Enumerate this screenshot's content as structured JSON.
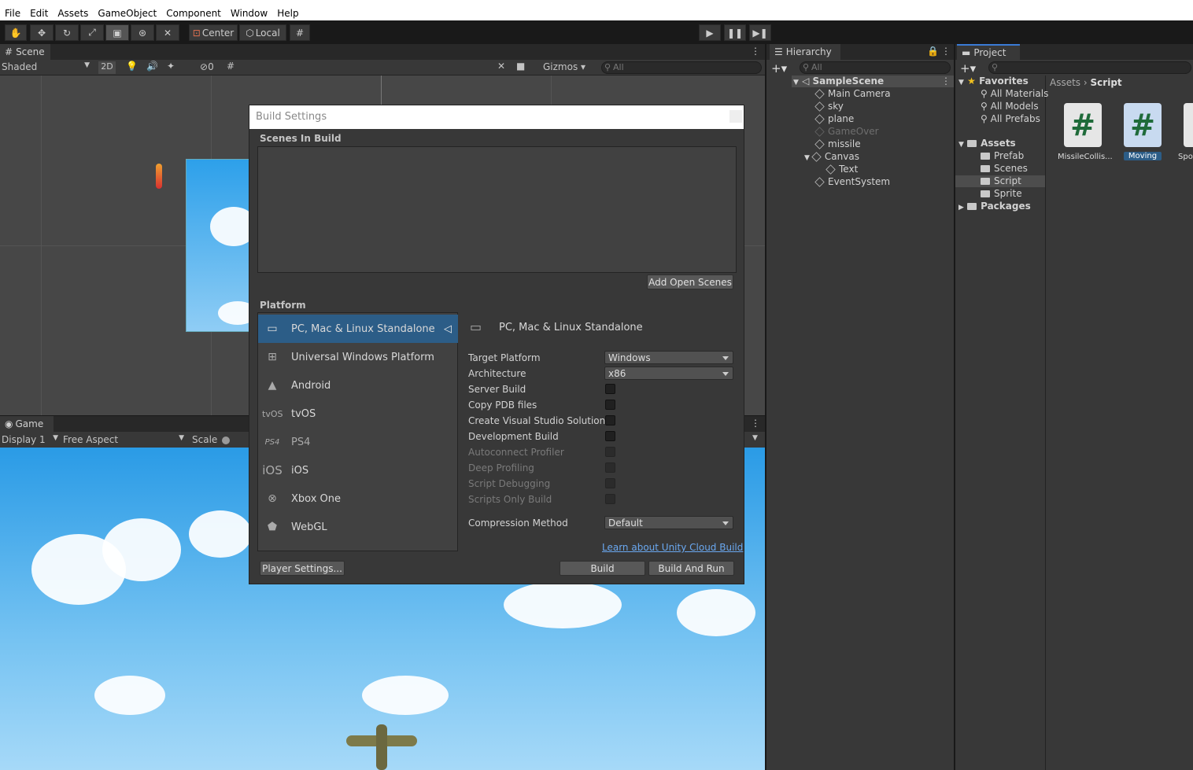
{
  "menu": [
    "File",
    "Edit",
    "Assets",
    "GameObject",
    "Component",
    "Window",
    "Help"
  ],
  "toolbar": {
    "center": "Center",
    "local": "Local"
  },
  "scene": {
    "tab": "Scene",
    "shading": "Shaded",
    "mode_2d": "2D",
    "gizmos": "Gizmos",
    "search_placeholder": "All",
    "hidden_count": "0"
  },
  "game": {
    "tab": "Game",
    "display": "Display 1",
    "aspect": "Free Aspect",
    "scale": "Scale"
  },
  "dialog": {
    "title": "Build Settings",
    "scenes_header": "Scenes In Build",
    "add_open_scenes": "Add Open Scenes",
    "platform_header": "Platform",
    "platforms": [
      {
        "name": "PC, Mac & Linux Standalone",
        "icon": "monitor-icon",
        "selected": true
      },
      {
        "name": "Universal Windows Platform",
        "icon": "windows-icon"
      },
      {
        "name": "Android",
        "icon": "android-icon"
      },
      {
        "name": "tvOS",
        "icon": "tvos-icon",
        "icon_text": "tvOS"
      },
      {
        "name": "PS4",
        "icon": "ps4-icon",
        "icon_text": "PS4"
      },
      {
        "name": "iOS",
        "icon": "ios-icon",
        "icon_text": "iOS"
      },
      {
        "name": "Xbox One",
        "icon": "xbox-icon"
      },
      {
        "name": "WebGL",
        "icon": "html5-icon"
      }
    ],
    "selected_platform": "PC, Mac & Linux Standalone",
    "settings": {
      "target_platform_label": "Target Platform",
      "target_platform": "Windows",
      "architecture_label": "Architecture",
      "architecture": "x86",
      "server_build": "Server Build",
      "copy_pdb": "Copy PDB files",
      "create_vs": "Create Visual Studio Solution",
      "dev_build": "Development Build",
      "autoconnect": "Autoconnect Profiler",
      "deep_profiling": "Deep Profiling",
      "script_debugging": "Script Debugging",
      "scripts_only": "Scripts Only Build",
      "compression_label": "Compression Method",
      "compression": "Default"
    },
    "cloud_link": "Learn about Unity Cloud Build",
    "player_settings": "Player Settings...",
    "build": "Build",
    "build_and_run": "Build And Run"
  },
  "hierarchy": {
    "tab": "Hierarchy",
    "search_placeholder": "All",
    "scene": "SampleScene",
    "items": [
      "Main Camera",
      "sky",
      "plane",
      "GameOver",
      "missile",
      "Canvas",
      "Text",
      "EventSystem"
    ]
  },
  "project": {
    "tab": "Project",
    "favorites": "Favorites",
    "fav_items": [
      "All Materials",
      "All Models",
      "All Prefabs"
    ],
    "assets": "Assets",
    "asset_folders": [
      "Prefab",
      "Scenes",
      "Script",
      "Sprite"
    ],
    "packages": "Packages",
    "breadcrumb": [
      "Assets",
      "Script"
    ],
    "files": [
      "MissileCollis...",
      "Moving",
      "Spo"
    ]
  }
}
